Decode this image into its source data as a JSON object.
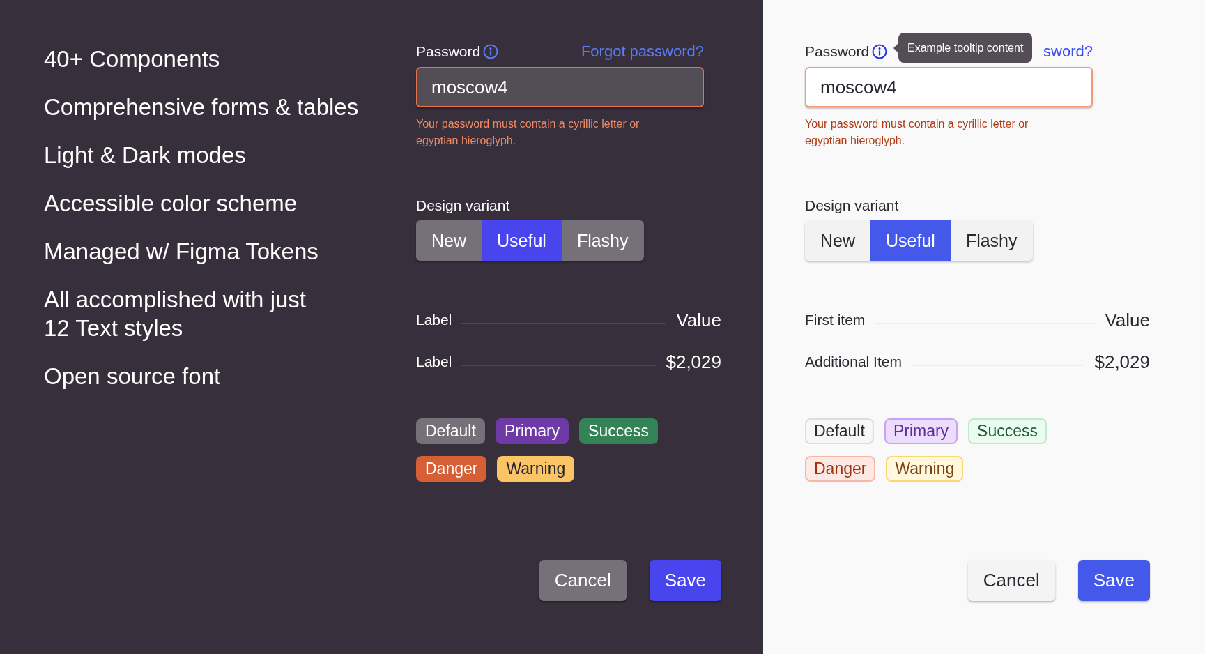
{
  "features": [
    "40+ Components",
    "Comprehensive forms & tables",
    "Light & Dark modes",
    "Accessible color scheme",
    "Managed w/ Figma Tokens",
    "All accomplished with just\n12 Text styles",
    "Open source font"
  ],
  "panels": [
    {
      "kind": "dark",
      "password": {
        "label": "Password",
        "link": "Forgot password?",
        "value": "moscow4",
        "invalid": true,
        "error": "Your password must contain a cyrillic letter or egyptian hieroglyph."
      },
      "variant": {
        "label": "Design variant",
        "options": [
          {
            "label": "New",
            "selected": false
          },
          {
            "label": "Useful",
            "selected": true
          },
          {
            "label": "Flashy",
            "selected": false
          }
        ]
      },
      "details": [
        {
          "label": "Label",
          "value": "Value"
        },
        {
          "label": "Label",
          "value": "$2,029"
        }
      ],
      "tags": [
        {
          "kind": "default",
          "label": "Default"
        },
        {
          "kind": "primary",
          "label": "Primary"
        },
        {
          "kind": "success",
          "label": "Success"
        },
        {
          "kind": "danger",
          "label": "Danger"
        },
        {
          "kind": "warning",
          "label": "Warning"
        }
      ],
      "buttons": [
        {
          "kind": "secondary",
          "label": "Cancel"
        },
        {
          "kind": "primary",
          "label": "Save"
        }
      ]
    },
    {
      "kind": "light",
      "password": {
        "label": "Password",
        "link": "sword?",
        "value": "moscow4",
        "invalid": true,
        "error": "Your password must contain a cyrillic letter or egyptian hieroglyph.",
        "tooltip": "Example tooltip content"
      },
      "variant": {
        "label": "Design variant",
        "options": [
          {
            "label": "New",
            "selected": false
          },
          {
            "label": "Useful",
            "selected": true
          },
          {
            "label": "Flashy",
            "selected": false
          }
        ]
      },
      "details": [
        {
          "label": "First item",
          "value": "Value"
        },
        {
          "label": "Additional Item",
          "value": "$2,029"
        }
      ],
      "tags": [
        {
          "kind": "default",
          "label": "Default"
        },
        {
          "kind": "primary",
          "label": "Primary"
        },
        {
          "kind": "success",
          "label": "Success"
        },
        {
          "kind": "danger",
          "label": "Danger"
        },
        {
          "kind": "warning",
          "label": "Warning"
        }
      ],
      "buttons": [
        {
          "kind": "secondary",
          "label": "Cancel"
        },
        {
          "kind": "primary",
          "label": "Save"
        }
      ]
    }
  ]
}
